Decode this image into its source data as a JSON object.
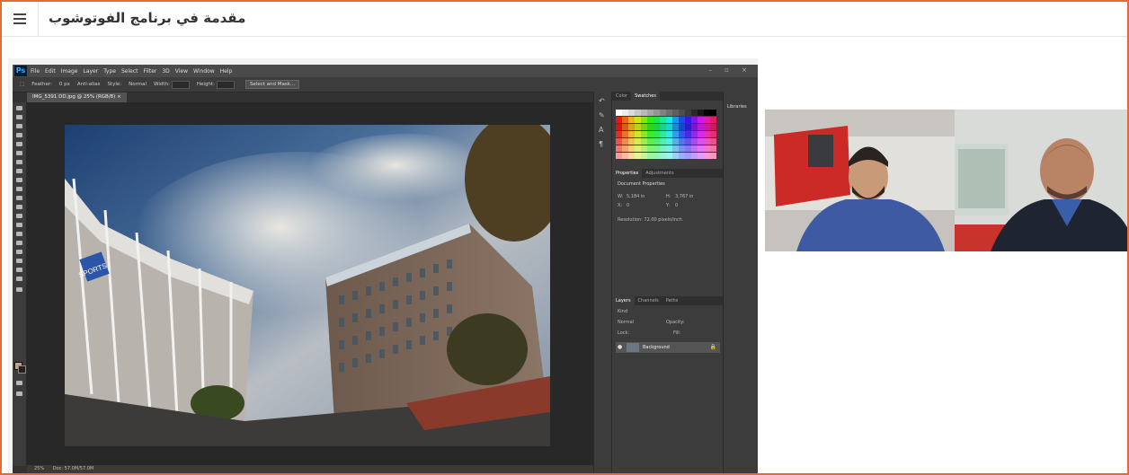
{
  "header": {
    "menu_icon": "hamburger-menu-icon",
    "course_title": "مقدمة في برنامج الفوتوشوب"
  },
  "photoshop": {
    "logo": "Ps",
    "menu": [
      "File",
      "Edit",
      "Image",
      "Layer",
      "Type",
      "Select",
      "Filter",
      "3D",
      "View",
      "Window",
      "Help"
    ],
    "options": {
      "feather_label": "Feather:",
      "feather_value": "0 px",
      "antialias_label": "Anti-alias",
      "style_label": "Style:",
      "style_value": "Normal",
      "width_label": "Width:",
      "height_label": "Height:",
      "select_mask_button": "Select and Mask..."
    },
    "document_tab": "IMG_5391 DD.jpg @ 25% (RGB/8) ×",
    "status": {
      "zoom": "25%",
      "doc": "Doc: 57.0M/57.0M"
    },
    "panels": {
      "color_tabs": [
        "Color",
        "Swatches"
      ],
      "libraries_label": "Libraries",
      "properties_tabs": [
        "Properties",
        "Adjustments"
      ],
      "document_properties": "Document Properties",
      "w_label": "W:",
      "w_value": "5,184 in",
      "h_label": "H:",
      "h_value": "3,767 in",
      "x_label": "X:",
      "x_value": "0",
      "y_label": "Y:",
      "y_value": "0",
      "resolution": "Resolution: 72.00 pixels/inch",
      "layers_tabs": [
        "Layers",
        "Channels",
        "Paths"
      ],
      "kind_label": "Kind",
      "blend_mode": "Normal",
      "opacity_label": "Opacity:",
      "lock_label": "Lock:",
      "fill_label": "Fill:",
      "layer_name": "Background"
    },
    "colors": {
      "fg": "#c9a27a",
      "bg": "#2a1f1a",
      "frame_accent": "#e46a3a"
    }
  },
  "video": {
    "participants": [
      "participant-1",
      "participant-2"
    ]
  }
}
